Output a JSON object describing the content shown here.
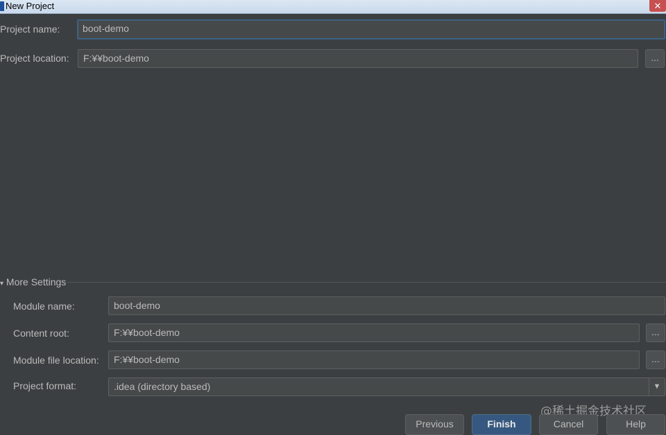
{
  "window": {
    "title": "New Project",
    "close_symbol": "✕"
  },
  "project": {
    "name_label": "Project name:",
    "name_value": "boot-demo",
    "location_label": "Project location:",
    "location_value": "F:¥¥boot-demo",
    "browse_label": "..."
  },
  "more_settings": {
    "toggle_symbol": "▾",
    "label": "More Settings",
    "module_name_label": "Module name:",
    "module_name_value": "boot-demo",
    "content_root_label": "Content root:",
    "content_root_value": "F:¥¥boot-demo",
    "module_file_location_label": "Module file location:",
    "module_file_location_value": "F:¥¥boot-demo",
    "project_format_label": "Project format:",
    "project_format_value": ".idea (directory based)",
    "combo_arrow": "▼",
    "browse_label": "..."
  },
  "buttons": {
    "previous": "Previous",
    "finish": "Finish",
    "cancel": "Cancel",
    "help": "Help"
  },
  "watermark": "@稀土掘金技术社区"
}
